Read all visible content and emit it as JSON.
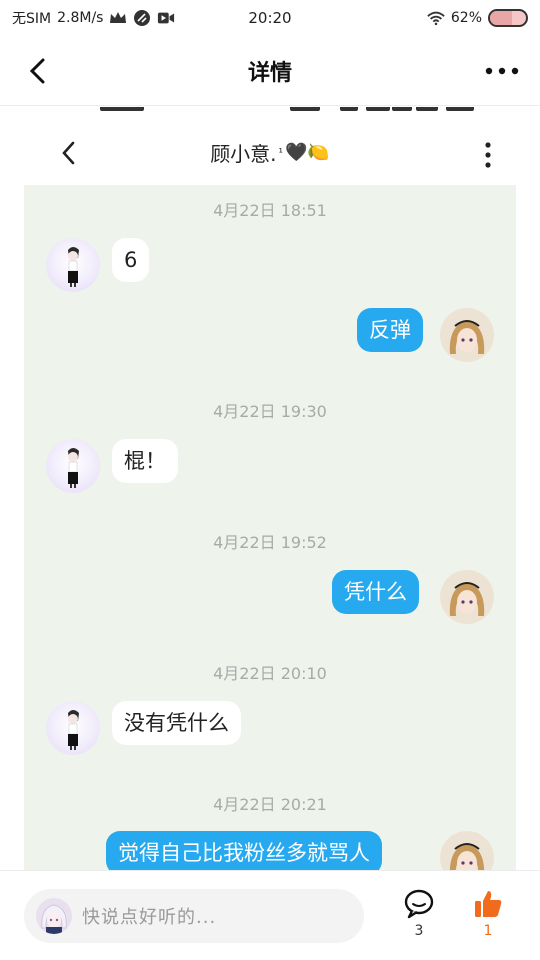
{
  "status_bar": {
    "carrier": "无SIM",
    "speed": "2.8M/s",
    "time": "20:20",
    "battery": "62%",
    "battery_level": 0.62
  },
  "header": {
    "title": "详情"
  },
  "chat": {
    "title": "顾小意.",
    "title_sup": "¹",
    "title_emoji": "🖤🍋",
    "messages": [
      {
        "type": "timestamp",
        "text": "4月22日 18:51"
      },
      {
        "type": "received",
        "text": "6"
      },
      {
        "type": "sent",
        "text": "反弹"
      },
      {
        "type": "timestamp",
        "text": "4月22日 19:30"
      },
      {
        "type": "received",
        "text": "棍！"
      },
      {
        "type": "timestamp",
        "text": "4月22日 19:52"
      },
      {
        "type": "sent",
        "text": "凭什么"
      },
      {
        "type": "timestamp",
        "text": "4月22日 20:10"
      },
      {
        "type": "received",
        "text": "没有凭什么"
      },
      {
        "type": "timestamp",
        "text": "4月22日 20:21"
      },
      {
        "type": "sent",
        "text": "觉得自己比我粉丝多就骂人"
      }
    ]
  },
  "bottom_bar": {
    "input_placeholder": "快说点好听的...",
    "comment_count": "3",
    "like_count": "1"
  },
  "colors": {
    "sent_bubble": "#27a9f0",
    "received_bubble": "#ffffff",
    "chat_background": "#eef4ec",
    "like_orange": "#f26a1b"
  }
}
